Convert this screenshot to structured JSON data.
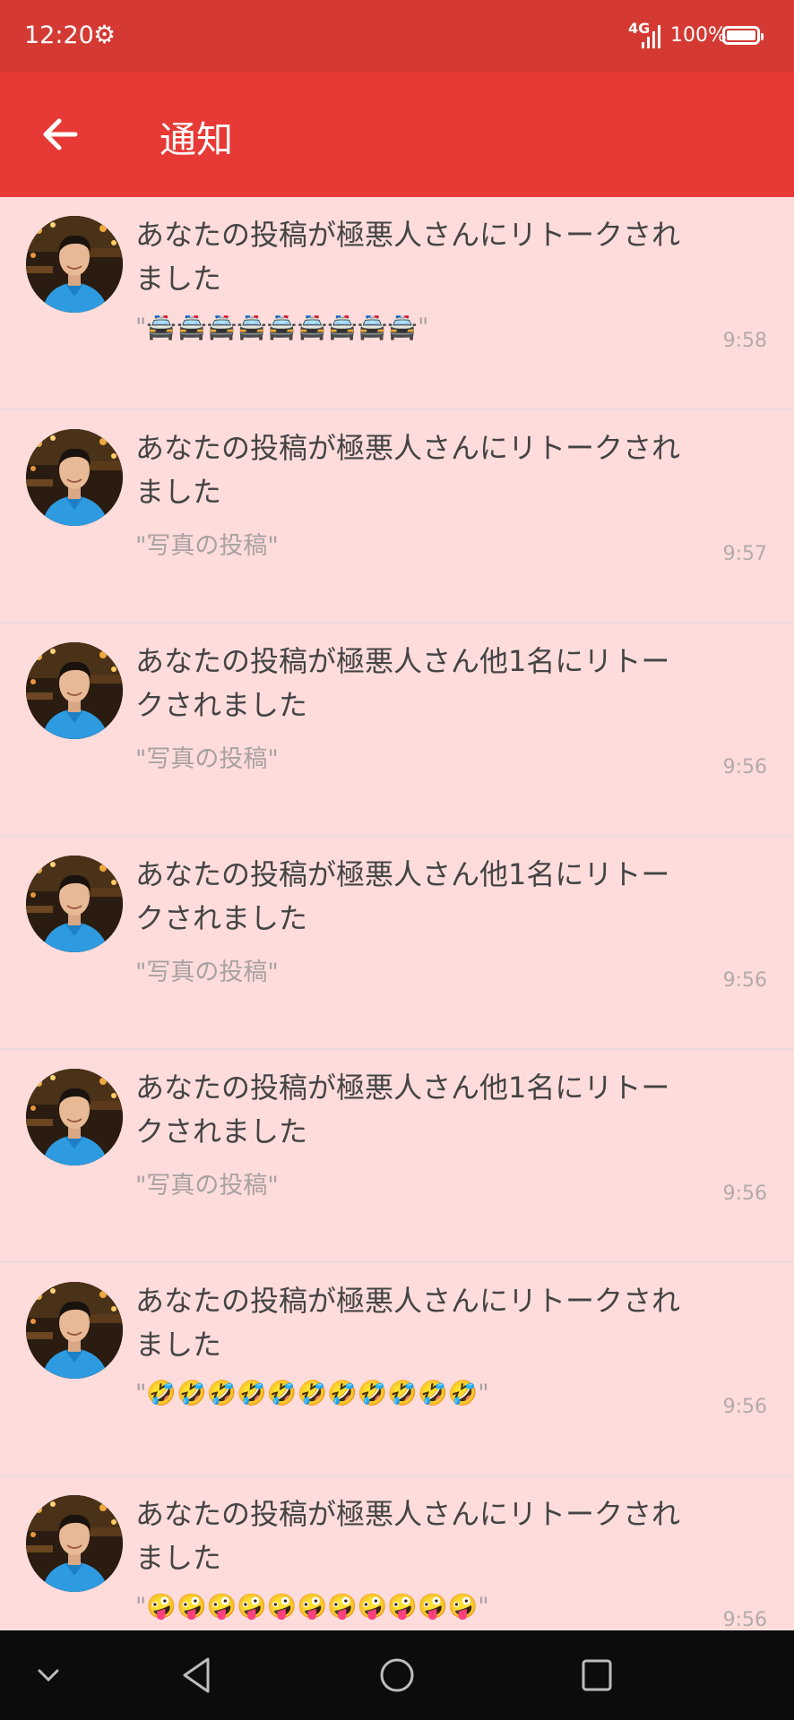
{
  "status_bar": {
    "time": "12:20",
    "network": "4G",
    "battery": "100%"
  },
  "app_bar": {
    "title": "通知"
  },
  "notifications": [
    {
      "message": "あなたの投稿が極悪人さんにリトークされました",
      "quote": "\"🚔🚔🚔🚔🚔🚔🚔🚔🚔\"",
      "time": "9:58"
    },
    {
      "message": "あなたの投稿が極悪人さんにリトークされました",
      "quote": "\"写真の投稿\"",
      "time": "9:57"
    },
    {
      "message": "あなたの投稿が極悪人さん他1名にリトークされました",
      "quote": "\"写真の投稿\"",
      "time": "9:56"
    },
    {
      "message": "あなたの投稿が極悪人さん他1名にリトークされました",
      "quote": "\"写真の投稿\"",
      "time": "9:56"
    },
    {
      "message": "あなたの投稿が極悪人さん他1名にリトークされました",
      "quote": "\"写真の投稿\"",
      "time": "9:56"
    },
    {
      "message": "あなたの投稿が極悪人さんにリトークされました",
      "quote": "\"🤣🤣🤣🤣🤣🤣🤣🤣🤣🤣🤣\"",
      "time": "9:56"
    },
    {
      "message": "あなたの投稿が極悪人さんにリトークされました",
      "quote": "\"🤪🤪🤪🤪🤪🤪🤪🤪🤪🤪🤪\"",
      "time": "9:56"
    }
  ],
  "icons": {
    "settings": "gear-icon",
    "back": "arrow-left-icon",
    "avatar": "user-avatar",
    "nav_hide": "chevron-down-icon",
    "nav_back": "triangle-back-icon",
    "nav_home": "circle-home-icon",
    "nav_recents": "square-recents-icon"
  },
  "colors": {
    "status_bar": "#d43a33",
    "app_bar": "#e73a36",
    "list_background": "#ffdcdc",
    "message_text": "#444444",
    "quote_text": "#a8a2a2",
    "time_text": "#b3aaaa",
    "nav_bar": "#0c0c0c"
  }
}
